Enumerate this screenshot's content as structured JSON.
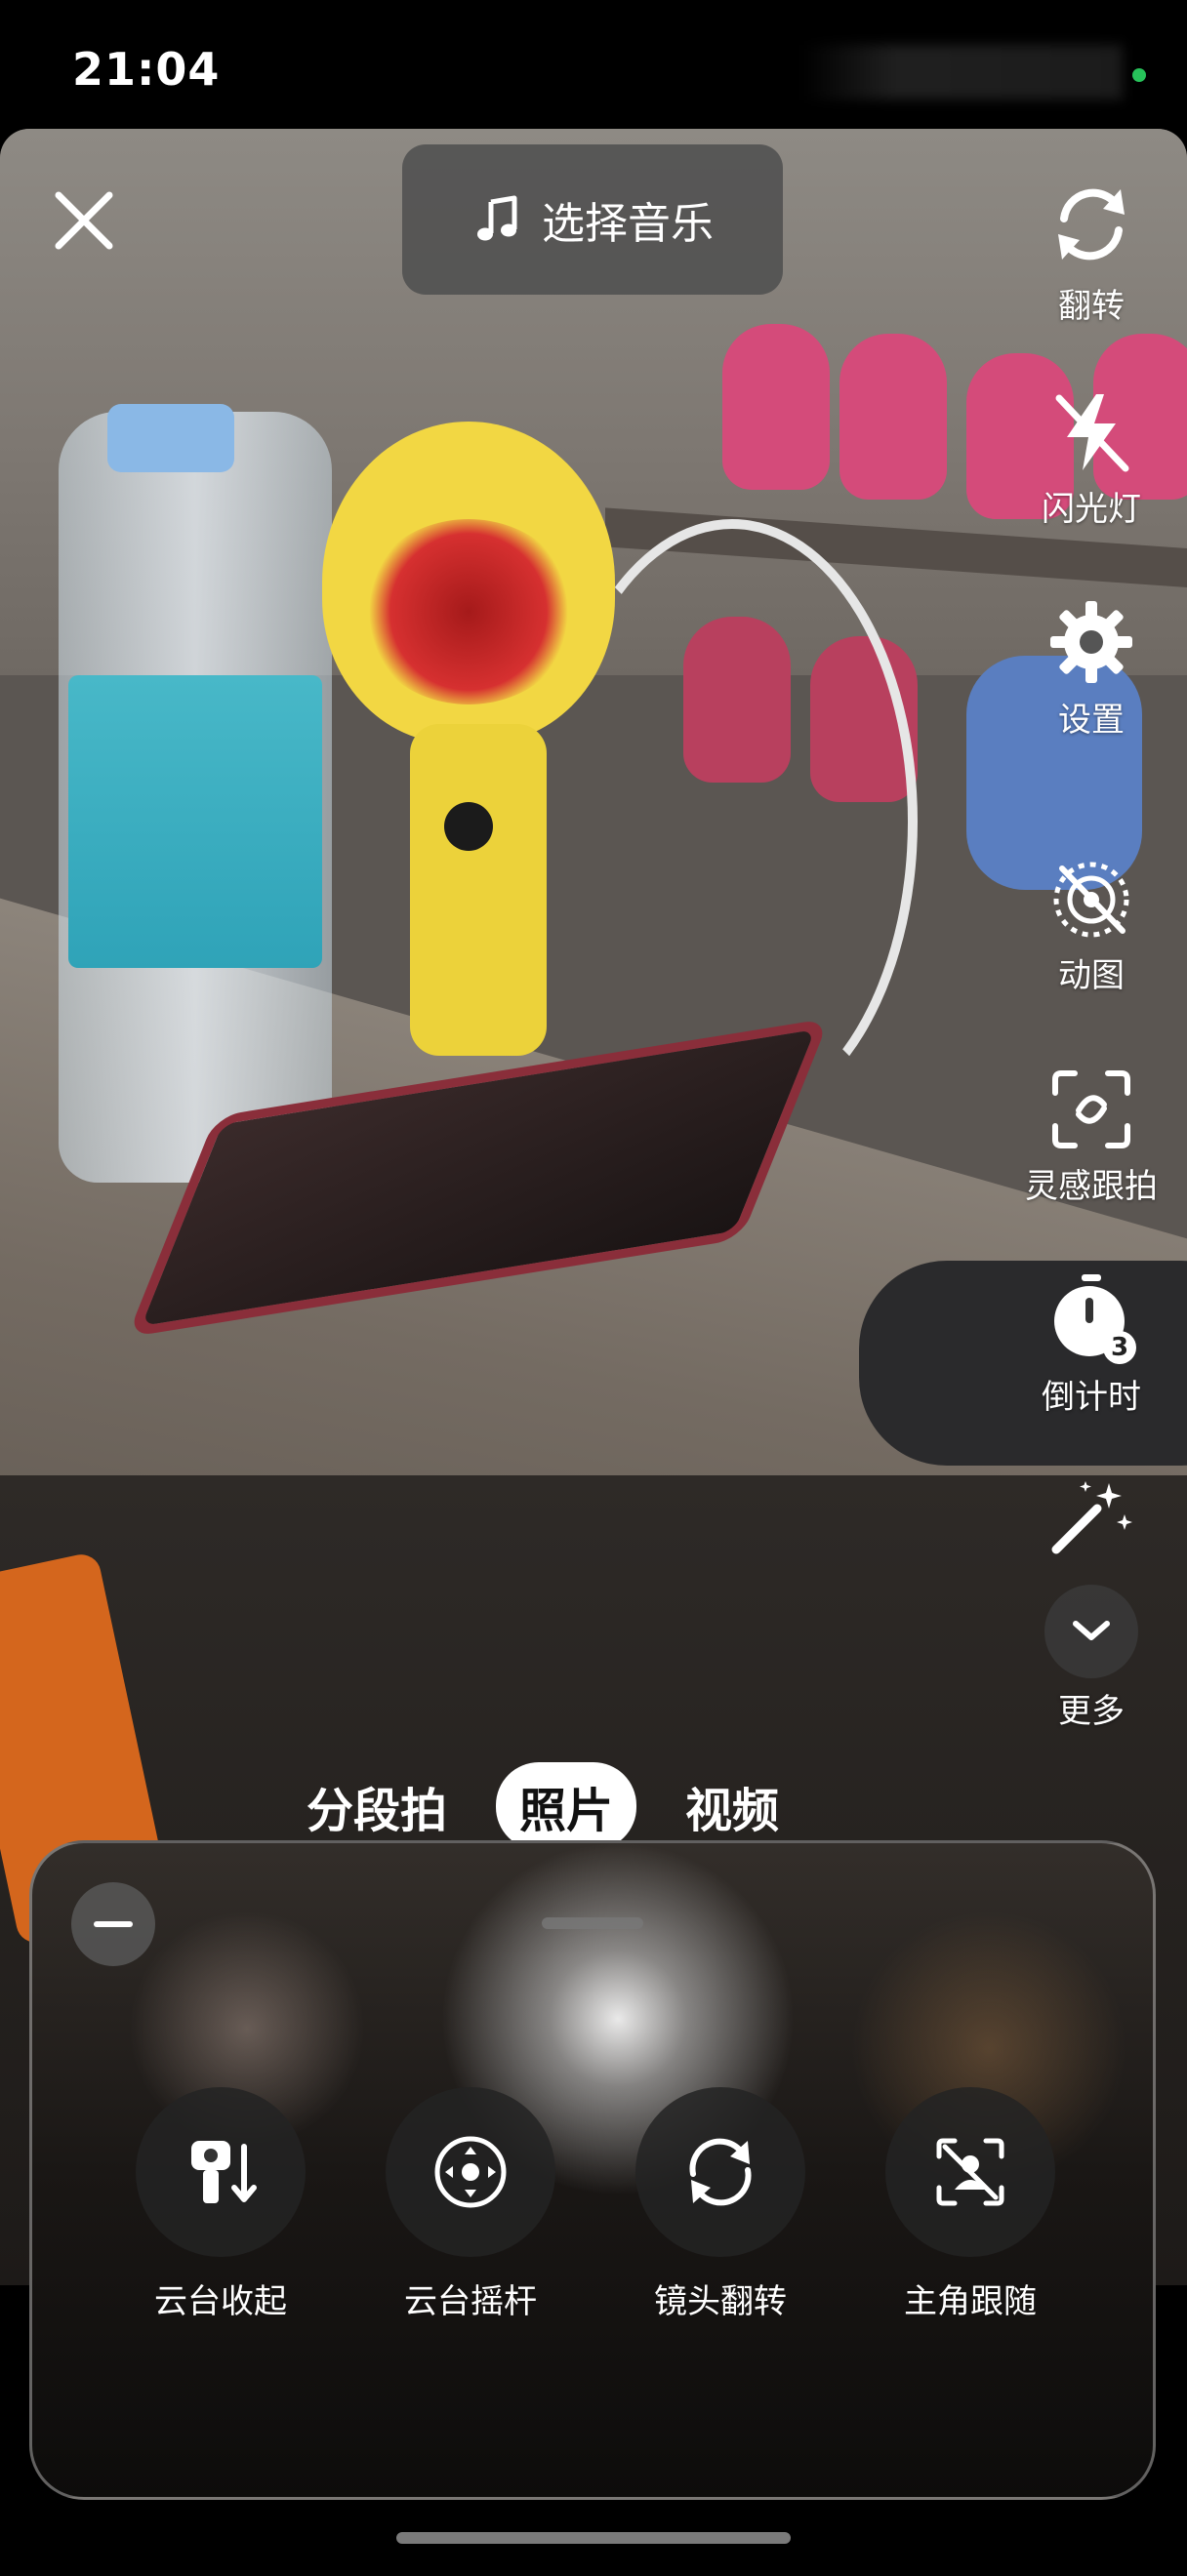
{
  "status_bar": {
    "time": "21:04"
  },
  "top_bar": {
    "close_icon": "close-icon",
    "music_label": "选择音乐",
    "music_icon": "music-note-icon"
  },
  "right_toolbar": {
    "items": [
      {
        "label": "翻转",
        "icon": "flip-camera-icon"
      },
      {
        "label": "闪光灯",
        "icon": "flash-off-icon"
      },
      {
        "label": "设置",
        "icon": "gear-icon"
      },
      {
        "label": "动图",
        "icon": "live-photo-off-icon"
      },
      {
        "label": "灵感跟拍",
        "icon": "focus-track-icon"
      },
      {
        "label": "倒计时",
        "icon": "timer-icon",
        "badge": "3"
      },
      {
        "label": "",
        "icon": "magic-wand-icon"
      },
      {
        "label": "更多",
        "icon": "chevron-down-icon"
      }
    ]
  },
  "modes": {
    "tabs": [
      "分段拍",
      "照片",
      "视频"
    ],
    "active": "照片"
  },
  "gimbal_panel": {
    "items": [
      {
        "label": "云台收起",
        "icon": "gimbal-fold-icon"
      },
      {
        "label": "云台摇杆",
        "icon": "joystick-icon"
      },
      {
        "label": "镜头翻转",
        "icon": "lens-flip-icon"
      },
      {
        "label": "主角跟随",
        "icon": "subject-follow-off-icon"
      }
    ]
  },
  "colors": {
    "accent_status_dot": "#27c25a",
    "panel_background": "#1a1715",
    "active_tab_bg": "#ffffff"
  }
}
